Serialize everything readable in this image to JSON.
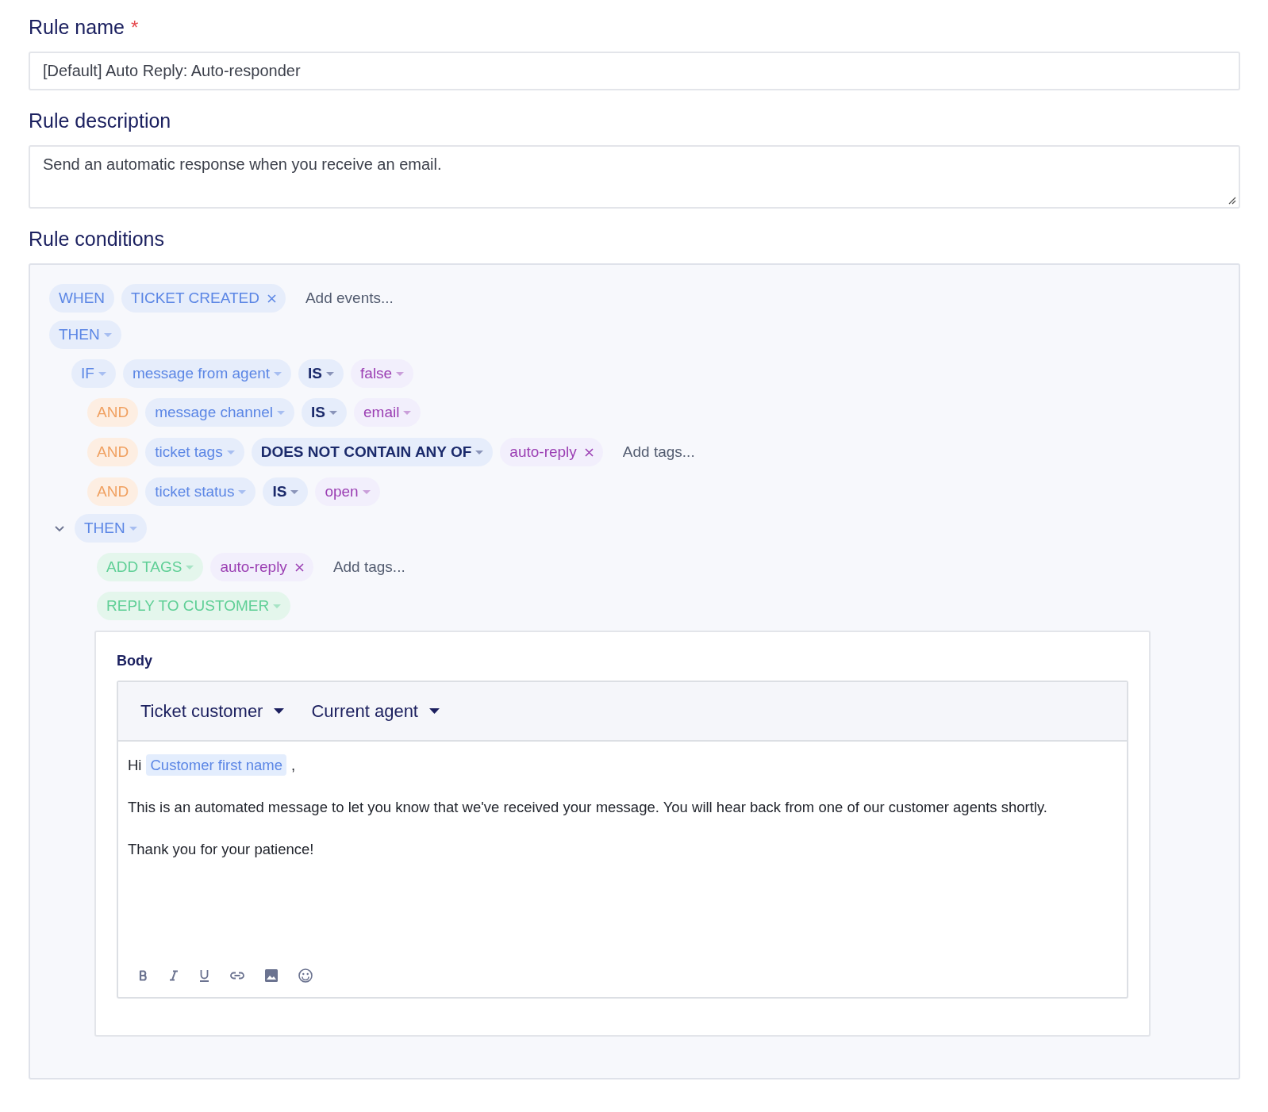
{
  "rule_name": {
    "label": "Rule name",
    "required_mark": "*",
    "value": "[Default] Auto Reply: Auto-responder"
  },
  "rule_description": {
    "label": "Rule description",
    "value": "Send an automatic response when you receive an email."
  },
  "rule_conditions": {
    "label": "Rule conditions",
    "blocks": [
      {
        "pills": [
          {
            "kind": "keyword",
            "text": "WHEN"
          },
          {
            "kind": "keyword",
            "text": "TICKET CREATED",
            "removable": true
          },
          {
            "kind": "adder",
            "placeholder": "Add events..."
          }
        ]
      },
      {
        "pills": [
          {
            "kind": "keyword",
            "text": "THEN",
            "has_menu": true
          }
        ],
        "children": [
          {
            "pills": [
              {
                "kind": "keyword",
                "text": "IF",
                "has_menu": true
              },
              {
                "kind": "field",
                "text": "message from agent",
                "has_menu": true
              },
              {
                "kind": "operator",
                "text": "IS",
                "has_menu": true
              },
              {
                "kind": "value",
                "text": "false",
                "has_menu": true
              }
            ],
            "children": [
              {
                "pills": [
                  {
                    "kind": "and",
                    "text": "AND"
                  },
                  {
                    "kind": "field",
                    "text": "message channel",
                    "has_menu": true
                  },
                  {
                    "kind": "operator",
                    "text": "IS",
                    "has_menu": true
                  },
                  {
                    "kind": "value",
                    "text": "email",
                    "has_menu": true
                  }
                ]
              },
              {
                "pills": [
                  {
                    "kind": "and",
                    "text": "AND"
                  },
                  {
                    "kind": "field",
                    "text": "ticket tags",
                    "has_menu": true
                  },
                  {
                    "kind": "operator",
                    "text": "DOES NOT CONTAIN ANY OF",
                    "has_menu": true
                  },
                  {
                    "kind": "tag",
                    "text": "auto-reply",
                    "removable": true
                  },
                  {
                    "kind": "adder",
                    "placeholder": "Add tags..."
                  }
                ]
              },
              {
                "pills": [
                  {
                    "kind": "and",
                    "text": "AND"
                  },
                  {
                    "kind": "field",
                    "text": "ticket status",
                    "has_menu": true
                  },
                  {
                    "kind": "operator",
                    "text": "IS",
                    "has_menu": true
                  },
                  {
                    "kind": "value",
                    "text": "open",
                    "has_menu": true
                  }
                ]
              }
            ]
          }
        ]
      },
      {
        "pills": [
          {
            "kind": "keyword",
            "text": "THEN",
            "has_menu": true
          }
        ],
        "expanded": true,
        "children": [
          {
            "pills": [
              {
                "kind": "action",
                "text": "ADD TAGS",
                "has_menu": true
              },
              {
                "kind": "tag",
                "text": "auto-reply",
                "removable": true
              },
              {
                "kind": "adder",
                "placeholder": "Add tags..."
              }
            ]
          },
          {
            "pills": [
              {
                "kind": "action",
                "text": "REPLY TO CUSTOMER",
                "has_menu": true
              }
            ],
            "editor": {
              "label": "Body",
              "variable_menus": [
                "Ticket customer",
                "Current agent"
              ],
              "paragraphs": [
                [
                  {
                    "kind": "text",
                    "text": "Hi"
                  },
                  {
                    "kind": "variable",
                    "text": "Customer first name"
                  },
                  {
                    "kind": "text",
                    "text": ","
                  }
                ],
                [
                  {
                    "kind": "text",
                    "text": "This is an automated message to let you know that we've received your message. You will hear back from one of our customer agents shortly."
                  }
                ],
                [
                  {
                    "kind": "text",
                    "text": "Thank you for your patience!"
                  }
                ]
              ]
            }
          }
        ]
      }
    ]
  }
}
